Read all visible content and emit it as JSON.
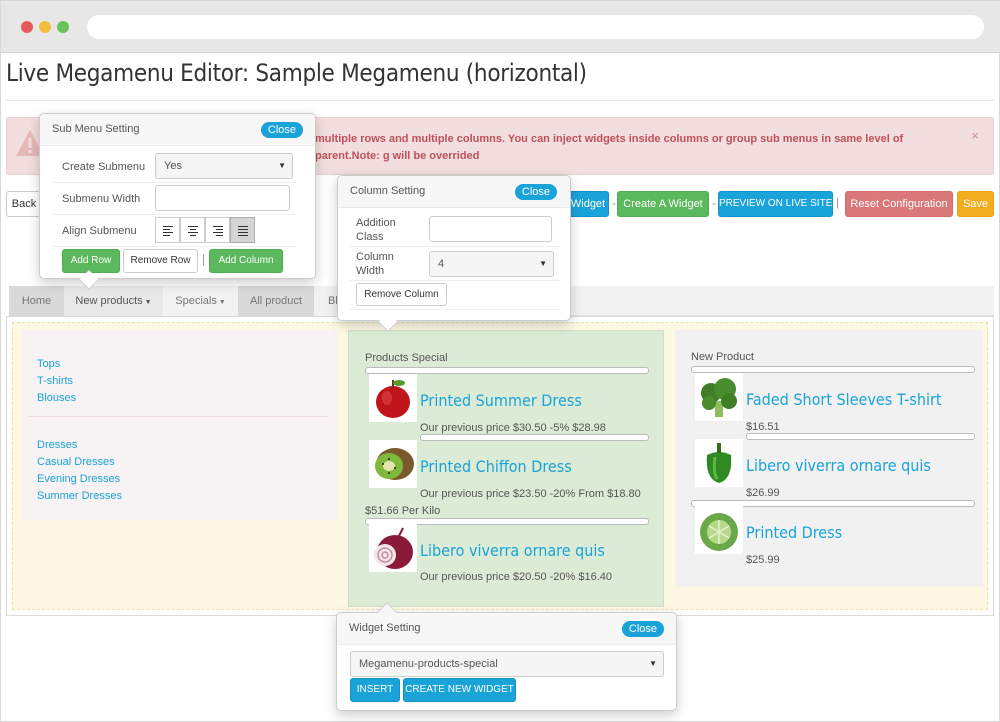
{
  "page_title": "Live Megamenu Editor: Sample Megamenu (horizontal)",
  "alert": {
    "text": "multiple rows and multiple columns. You can inject widgets inside columns or group sub menus in same level of parent.Note: g will be overrided",
    "close": "×"
  },
  "toolbar": {
    "back": "Back",
    "widget": "Widget",
    "create_widget": "Create A Widget",
    "preview": "PREVIEW ON LIVE SITE",
    "reset": "Reset Configuration",
    "save": "Save",
    "separator": "|"
  },
  "nav": {
    "tabs": [
      {
        "label": "Home"
      },
      {
        "label": "New products"
      },
      {
        "label": "Specials"
      },
      {
        "label": "All product"
      },
      {
        "label": "Bl"
      }
    ]
  },
  "col1": {
    "group1": [
      "Tops",
      "T-shirts",
      "Blouses"
    ],
    "group2": [
      "Dresses",
      "Casual Dresses",
      "Evening Dresses",
      "Summer Dresses"
    ]
  },
  "col2": {
    "title": "Products Special",
    "products": [
      {
        "name": "Printed Summer Dress",
        "price": "Our previous price $30.50 -5% $28.98",
        "extra": "",
        "image": "apple"
      },
      {
        "name": "Printed Chiffon Dress",
        "price": "Our previous price $23.50 -20% From $18.80",
        "extra": "$51.66 Per Kilo",
        "image": "kiwi"
      },
      {
        "name": "Libero viverra ornare quis",
        "price": "Our previous price $20.50 -20% $16.40",
        "extra": "",
        "image": "onion"
      }
    ]
  },
  "col3": {
    "title": "New Product",
    "products": [
      {
        "name": "Faded Short Sleeves T-shirt",
        "price": "$16.51",
        "image": "broccoli"
      },
      {
        "name": "Libero viverra ornare quis",
        "price": "$26.99",
        "image": "pepper"
      },
      {
        "name": "Printed Dress",
        "price": "$25.99",
        "image": "cabbage"
      }
    ]
  },
  "submenu_setting": {
    "title": "Sub Menu Setting",
    "close": "Close",
    "create_submenu_label": "Create Submenu",
    "create_submenu_value": "Yes",
    "submenu_width_label": "Submenu Width",
    "submenu_width_value": "",
    "align_label": "Align Submenu",
    "add_row": "Add Row",
    "remove_row": "Remove Row",
    "add_column": "Add Column",
    "separator": "|"
  },
  "column_setting": {
    "title": "Column Setting",
    "close": "Close",
    "addition_class_label": "Addition Class",
    "addition_class_value": "",
    "column_width_label": "Column Width",
    "column_width_value": "4",
    "remove_column": "Remove Column"
  },
  "widget_setting": {
    "title": "Widget Setting",
    "close": "Close",
    "widget_value": "Megamenu-products-special",
    "insert": "INSERT",
    "create_new": "CREATE NEW WIDGET"
  },
  "colors": {
    "accent": "#1aa3d9",
    "green": "#5cb85c",
    "danger_text": "#c0505a",
    "alert_bg": "#f2dede"
  }
}
